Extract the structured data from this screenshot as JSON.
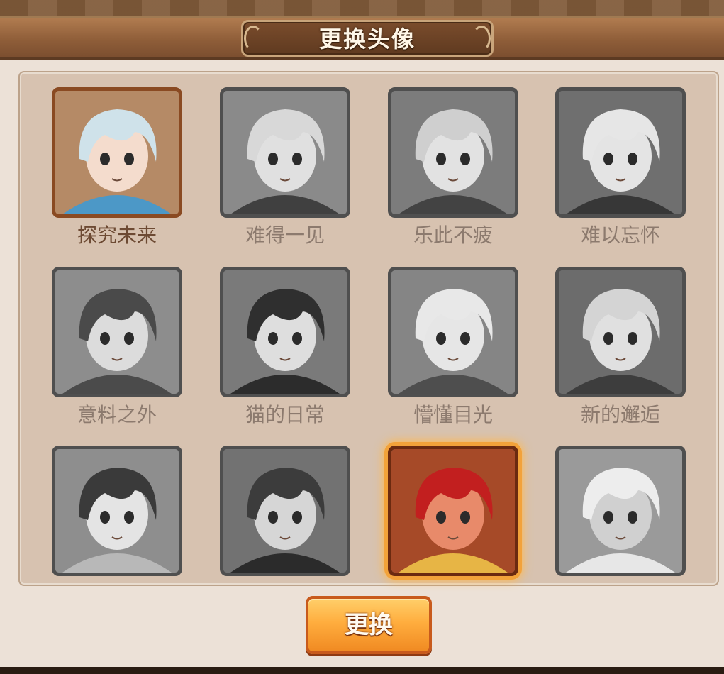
{
  "dialog": {
    "title": "更换头像"
  },
  "avatars": [
    {
      "label": "探究未来",
      "state": "selected",
      "hair": "#cfe2ea",
      "skin": "#f4dccd",
      "bg": "#b58a66",
      "accent": "#3a9ad8"
    },
    {
      "label": "难得一见",
      "state": "locked",
      "hair": "#d8d8d8",
      "skin": "#e0e0e0",
      "bg": "#8a8a8a",
      "accent": "#333333"
    },
    {
      "label": "乐此不疲",
      "state": "locked",
      "hair": "#cfcfcf",
      "skin": "#e2e2e2",
      "bg": "#7c7c7c",
      "accent": "#3a3a3a"
    },
    {
      "label": "难以忘怀",
      "state": "locked",
      "hair": "#e6e6e6",
      "skin": "#e4e4e4",
      "bg": "#6f6f6f",
      "accent": "#2e2e2e"
    },
    {
      "label": "意料之外",
      "state": "locked",
      "hair": "#4a4a4a",
      "skin": "#dcdcdc",
      "bg": "#8d8d8d",
      "accent": "#3f3f3f"
    },
    {
      "label": "猫的日常",
      "state": "locked",
      "hair": "#2f2f2f",
      "skin": "#dedede",
      "bg": "#7a7a7a",
      "accent": "#1f1f1f"
    },
    {
      "label": "懵懂目光",
      "state": "locked",
      "hair": "#e8e8e8",
      "skin": "#e6e6e6",
      "bg": "#858585",
      "accent": "#444444"
    },
    {
      "label": "新的邂逅",
      "state": "locked",
      "hair": "#d4d4d4",
      "skin": "#e0e0e0",
      "bg": "#6c6c6c",
      "accent": "#353535"
    },
    {
      "label": "",
      "state": "locked",
      "hair": "#3a3a3a",
      "skin": "#e4e4e4",
      "bg": "#8e8e8e",
      "accent": "#c0c0c0"
    },
    {
      "label": "",
      "state": "locked",
      "hair": "#3c3c3c",
      "skin": "#d6d6d6",
      "bg": "#727272",
      "accent": "#1e1e1e"
    },
    {
      "label": "",
      "state": "current",
      "hair": "#c21f1f",
      "skin": "#e88a6a",
      "bg": "#a64a28",
      "accent": "#f2c84a"
    },
    {
      "label": "",
      "state": "locked",
      "hair": "#ededed",
      "skin": "#d0d0d0",
      "bg": "#9a9a9a",
      "accent": "#f4f4f4"
    }
  ],
  "confirm_button": {
    "label": "更换"
  }
}
